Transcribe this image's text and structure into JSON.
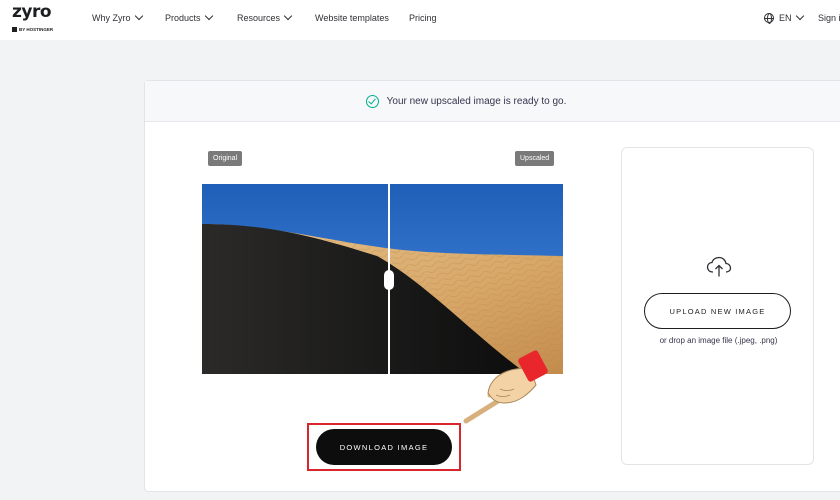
{
  "nav": {
    "logo_word": "zyro",
    "logo_byline": "BY HOSTINGER",
    "items": [
      {
        "label": "Why Zyro",
        "dropdown": true
      },
      {
        "label": "Products",
        "dropdown": true
      },
      {
        "label": "Resources",
        "dropdown": true
      },
      {
        "label": "Website templates",
        "dropdown": false
      },
      {
        "label": "Pricing",
        "dropdown": false
      }
    ],
    "language": "EN",
    "sign_in": "Sign i"
  },
  "banner": {
    "icon": "check-circle-icon",
    "message": "Your new upscaled image is ready to go."
  },
  "comparison": {
    "left_tag": "Original",
    "right_tag": "Upscaled"
  },
  "actions": {
    "download_label": "DOWNLOAD IMAGE",
    "upload_label": "UPLOAD NEW IMAGE",
    "upload_hint": "or drop an image file (.jpeg, .png)",
    "upload_icon": "cloud-upload-icon"
  },
  "colors": {
    "highlight": "#d8262c",
    "success": "#00b090",
    "button_dark": "#0d0d0d"
  }
}
